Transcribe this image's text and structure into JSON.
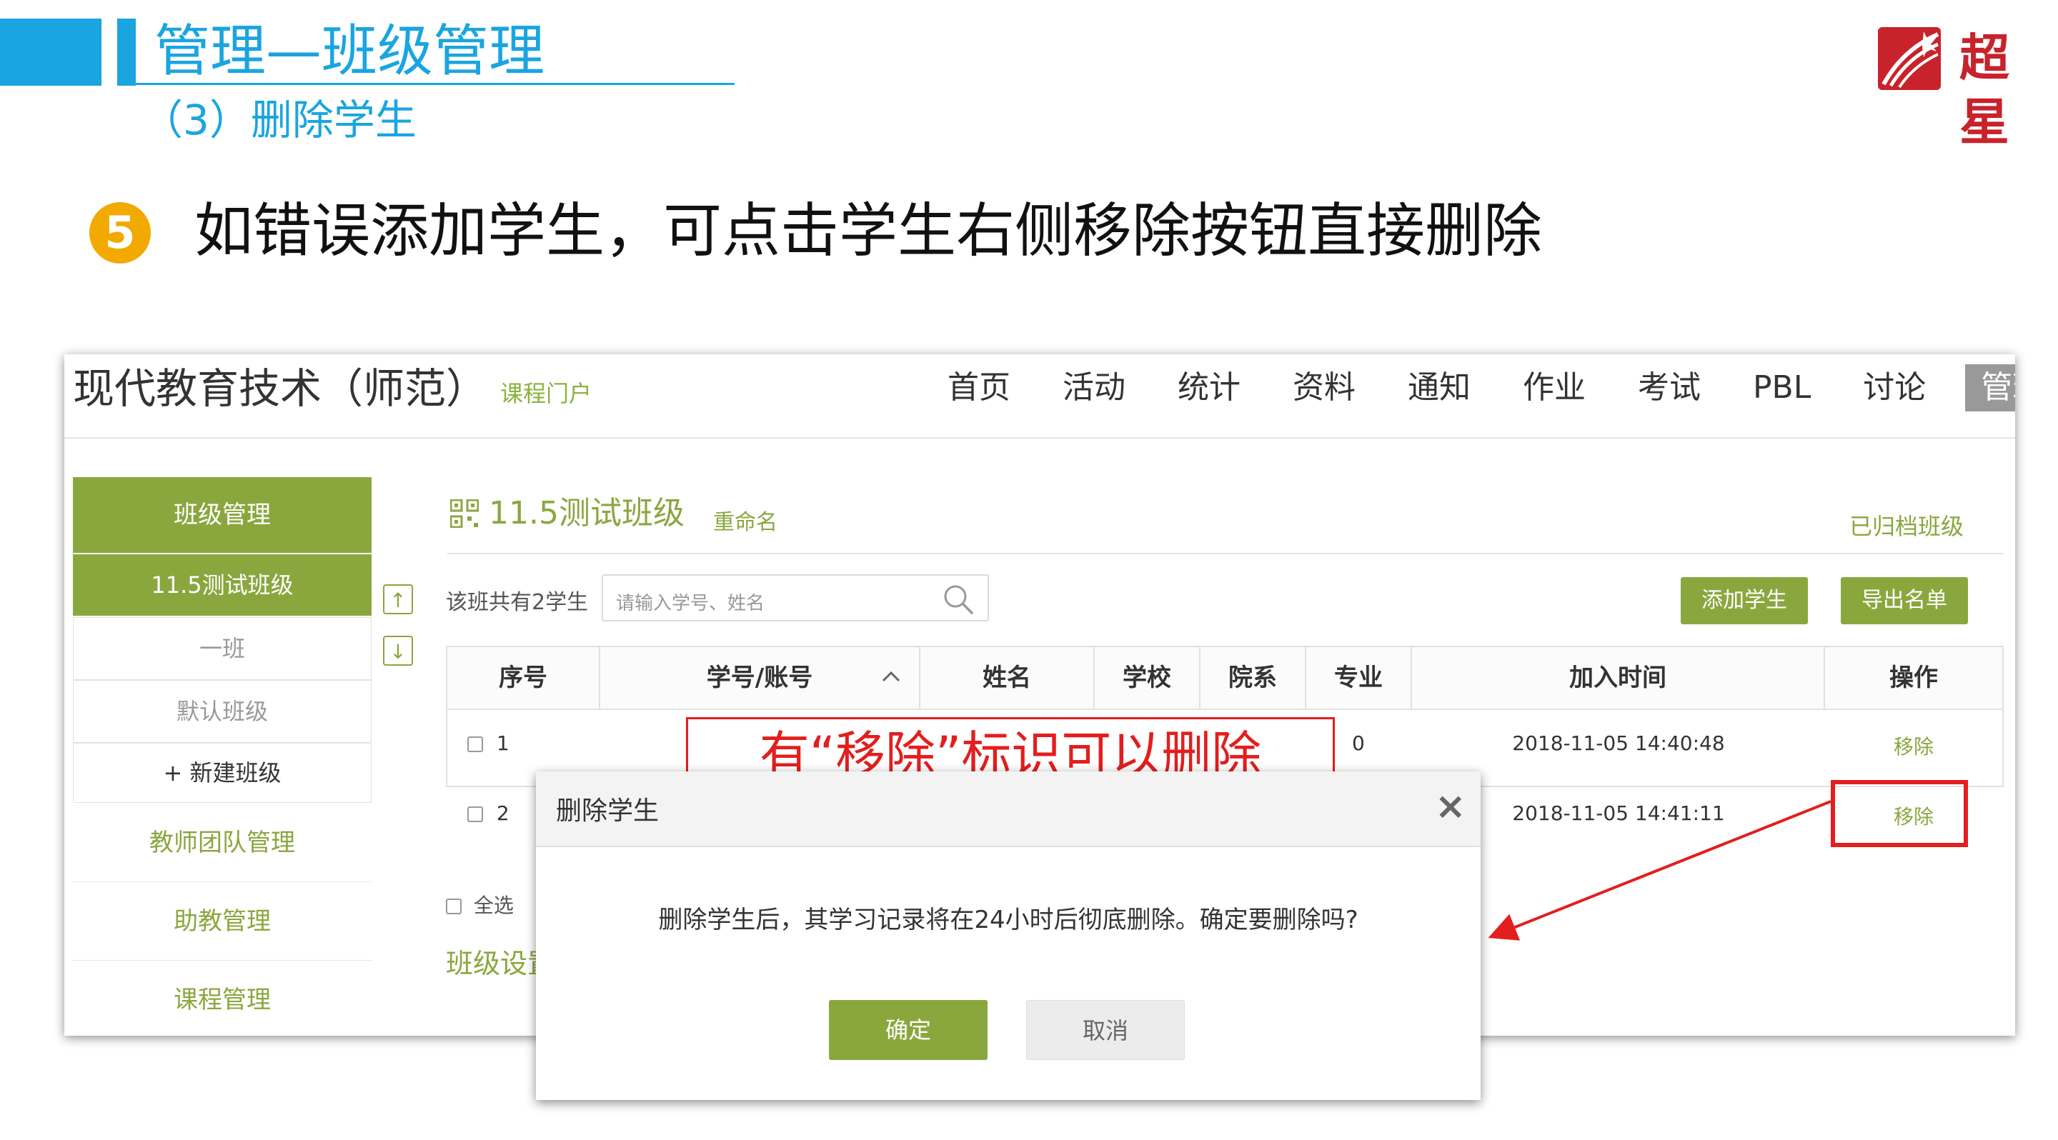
{
  "slide": {
    "title": "管理—班级管理",
    "subtitle": "（3）删除学生",
    "logo_text": "超星",
    "step_number": "5",
    "instruction": "如错误添加学生，可点击学生右侧移除按钮直接删除"
  },
  "colors": {
    "slide_accent": "#1aa5e0",
    "brand_green": "#8aa73e",
    "highlight_red": "#e31e1e",
    "step_badge": "#f2a900"
  },
  "app": {
    "course_title": "现代教育技术（师范）",
    "portal_link": "课程门户",
    "nav": [
      "首页",
      "活动",
      "统计",
      "资料",
      "通知",
      "作业",
      "考试",
      "PBL",
      "讨论",
      "管理"
    ],
    "nav_active": "管理",
    "sidebar": {
      "section": "班级管理",
      "classes": [
        "11.5测试班级",
        "一班",
        "默认班级"
      ],
      "new_class": "+ 新建班级",
      "items": [
        "教师团队管理",
        "助教管理",
        "课程管理"
      ]
    },
    "class_header": {
      "name": "11.5测试班级",
      "rename": "重命名",
      "archived": "已归档班级"
    },
    "toolbar": {
      "student_count": "该班共有2学生",
      "search_placeholder": "请输入学号、姓名",
      "add_student": "添加学生",
      "export_list": "导出名单"
    },
    "table": {
      "headers": [
        "序号",
        "学号/账号",
        "姓名",
        "学校",
        "院系",
        "专业",
        "加入时间",
        "操作"
      ],
      "rows": [
        {
          "index": "1",
          "major": "0",
          "joined": "2018-11-05 14:40:48",
          "action": "移除"
        },
        {
          "index": "2",
          "major": "",
          "joined": "2018-11-05 14:41:11",
          "action": "移除"
        }
      ]
    },
    "select_all": "全选",
    "class_settings": "班级设置"
  },
  "dialog": {
    "title": "删除学生",
    "close": "×",
    "message": "删除学生后，其学习记录将在24小时后彻底删除。确定要删除吗?",
    "confirm": "确定",
    "cancel": "取消"
  },
  "callout": {
    "text": "有“移除”标识可以删除"
  }
}
